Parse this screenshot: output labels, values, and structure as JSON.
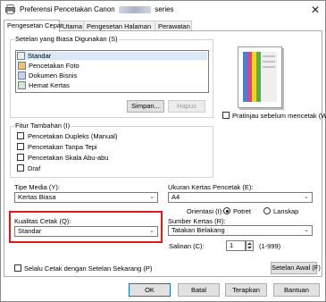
{
  "window": {
    "title_prefix": "Preferensi Pencetakan Canon",
    "title_suffix": "series",
    "close_symbol": "✕"
  },
  "tabs": [
    {
      "label": "Pengesetan Cepat",
      "active": true
    },
    {
      "label": "Utama",
      "active": false
    },
    {
      "label": "Pengesetan Halaman",
      "active": false
    },
    {
      "label": "Perawatan",
      "active": false
    }
  ],
  "common_settings": {
    "label": "Setelan yang Biasa Digunakan (S)",
    "items": [
      "Standar",
      "Pencetakan Foto",
      "Dokumen Bisnis",
      "Hemat Kertas"
    ],
    "selected_index": 0,
    "save_label": "Simpan...",
    "delete_label": "Hapus"
  },
  "preview": {
    "checkbox_label": "Pratinjau sebelum mencetak (W)",
    "checked": false
  },
  "additional_features": {
    "label": "Fitur Tambahan (I)",
    "items": [
      "Pencetakan Dupleks (Manual)",
      "Pencetakan Tanpa Tepi",
      "Pencetakan Skala Abu-abu",
      "Draf"
    ]
  },
  "media_type": {
    "label": "Tipe Media (Y):",
    "value": "Kertas Biasa"
  },
  "paper_size": {
    "label": "Ukuran Kertas Pencetak (E):",
    "value": "A4"
  },
  "orientation": {
    "label": "Orientasi (I):",
    "options": [
      "Potret",
      "Lanskap"
    ],
    "selected": "Potret"
  },
  "print_quality": {
    "label": "Kualitas Cetak (Q):",
    "value": "Standar"
  },
  "paper_source": {
    "label": "Sumber Kertas (R):",
    "value": "Tatakan Belakang"
  },
  "copies": {
    "label": "Salinan (C):",
    "value": "1",
    "range": "(1-999)"
  },
  "always_print": {
    "label": "Selalu Cetak dengan Setelan Sekarang (P)",
    "checked": false
  },
  "defaults_label": "Setelan Awal (F)",
  "footer": {
    "ok": "OK",
    "cancel": "Batal",
    "apply": "Terapkan",
    "help": "Bantuan"
  },
  "colors": {
    "highlight": "#e8161b",
    "button_face": "#e1e1e1"
  }
}
